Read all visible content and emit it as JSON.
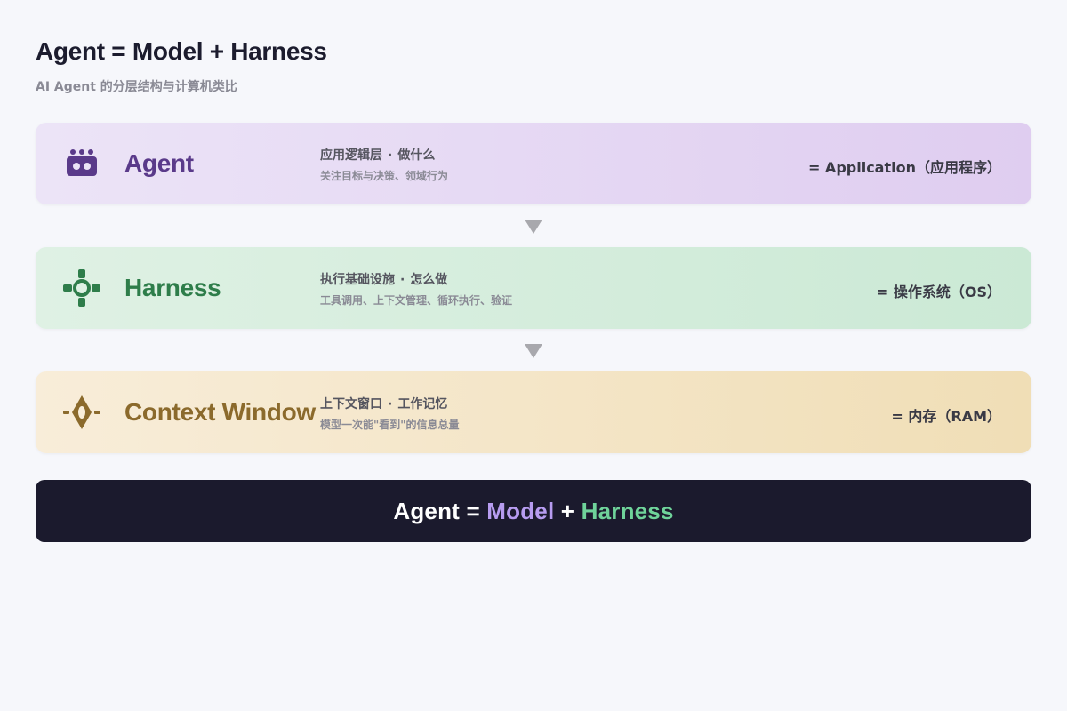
{
  "header": {
    "title": "Agent = Model + Harness",
    "subtitle": "AI Agent 的分层结构与计算机类比"
  },
  "layers": [
    {
      "icon": "robot-icon",
      "name": "Agent",
      "desc_main": "应用逻辑层",
      "desc_focus": "做什么",
      "desc_sub": "关注目标与决策、领域行为",
      "analogy": "= Application（应用程序）",
      "color": "#5a3a8a"
    },
    {
      "icon": "gear-icon",
      "name": "Harness",
      "desc_main": "执行基础设施",
      "desc_focus": "怎么做",
      "desc_sub": "工具调用、上下文管理、循环执行、验证",
      "analogy": "= 操作系统（OS）",
      "color": "#2e7d4a"
    },
    {
      "icon": "eye-icon",
      "name": "Context Window",
      "desc_main": "上下文窗口",
      "desc_focus": "工作记忆",
      "desc_sub": "模型一次能\"看到\"的信息总量",
      "analogy": "= 内存（RAM）",
      "color": "#8b6a2c"
    }
  ],
  "separator": "·",
  "formula": {
    "agent": "Agent",
    "equals": " = ",
    "model": "Model",
    "plus": " + ",
    "harness": "Harness",
    "model_color": "#b79cf0",
    "harness_color": "#6fd39a",
    "background": "#1b1a2d"
  }
}
